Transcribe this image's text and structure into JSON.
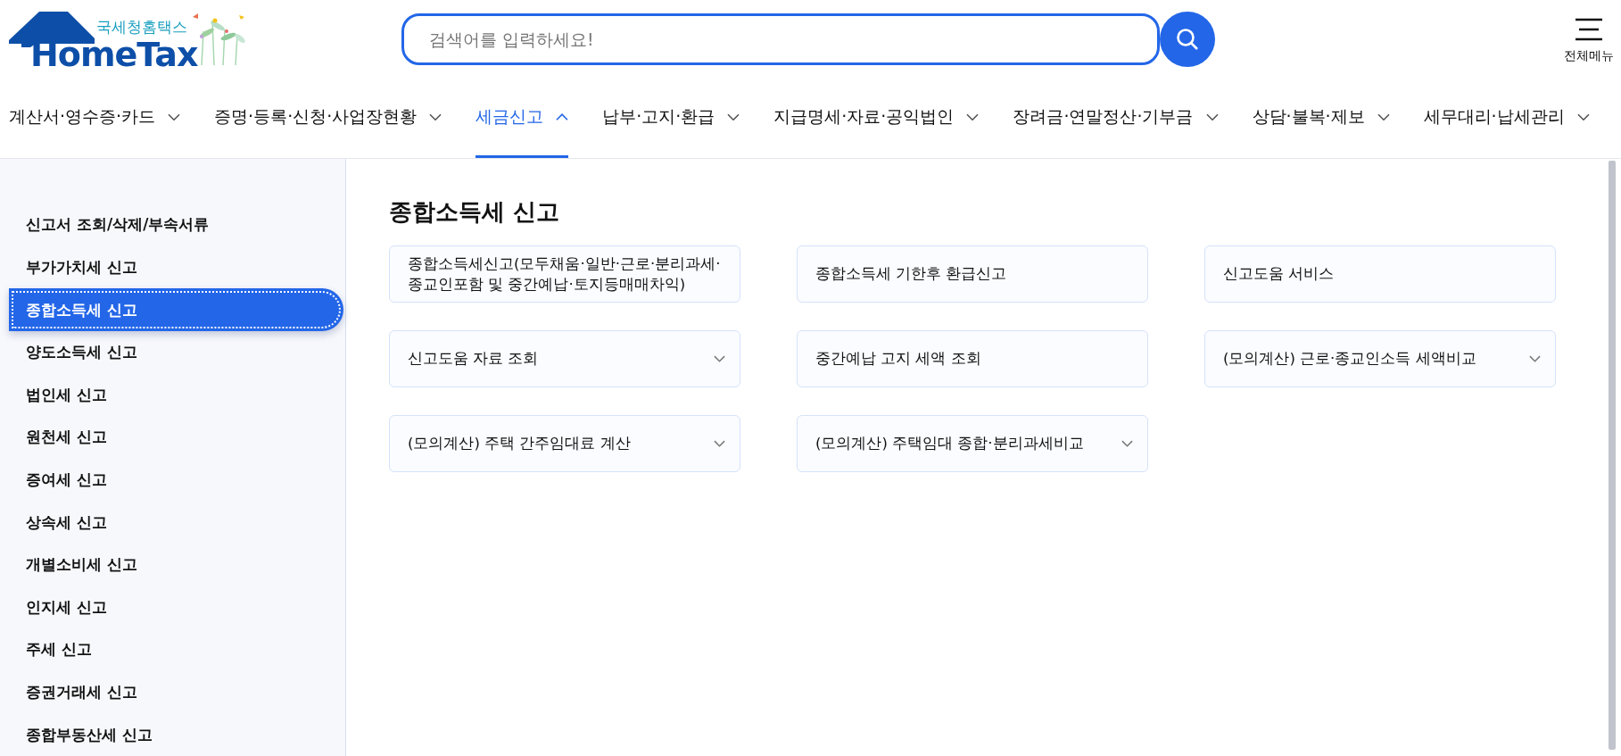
{
  "logo": {
    "subtitle": "국세청홈택스",
    "title": "HomeTax"
  },
  "search": {
    "placeholder": "검색어를 입력하세요!"
  },
  "all_menu": {
    "label": "전체메뉴"
  },
  "nav": [
    {
      "label": "계산서·영수증·카드",
      "selected": false
    },
    {
      "label": "증명·등록·신청·사업장현황",
      "selected": false
    },
    {
      "label": "세금신고",
      "selected": true
    },
    {
      "label": "납부·고지·환급",
      "selected": false
    },
    {
      "label": "지급명세·자료·공익법인",
      "selected": false
    },
    {
      "label": "장려금·연말정산·기부금",
      "selected": false
    },
    {
      "label": "상담·불복·제보",
      "selected": false
    },
    {
      "label": "세무대리·납세관리",
      "selected": false
    }
  ],
  "sidebar": {
    "items": [
      {
        "label": "신고서 조회/삭제/부속서류",
        "selected": false
      },
      {
        "label": "부가가치세 신고",
        "selected": false
      },
      {
        "label": "종합소득세 신고",
        "selected": true
      },
      {
        "label": "양도소득세 신고",
        "selected": false
      },
      {
        "label": "법인세 신고",
        "selected": false
      },
      {
        "label": "원천세 신고",
        "selected": false
      },
      {
        "label": "증여세 신고",
        "selected": false
      },
      {
        "label": "상속세 신고",
        "selected": false
      },
      {
        "label": "개별소비세 신고",
        "selected": false
      },
      {
        "label": "인지세 신고",
        "selected": false
      },
      {
        "label": "주세 신고",
        "selected": false
      },
      {
        "label": "증권거래세 신고",
        "selected": false
      },
      {
        "label": "종합부동산세 신고",
        "selected": false
      }
    ]
  },
  "content": {
    "title": "종합소득세 신고",
    "cards": [
      {
        "label": "종합소득세신고(모두채움·일반·근로·분리과세·종교인포함 및 중간예납·토지등매매차익)",
        "kind": "link"
      },
      {
        "label": "종합소득세 기한후 환급신고",
        "kind": "link"
      },
      {
        "label": "신고도움 서비스",
        "kind": "link"
      },
      {
        "label": "신고도움 자료 조회",
        "kind": "dropdown"
      },
      {
        "label": "중간예납 고지 세액 조회",
        "kind": "link"
      },
      {
        "label": "(모의계산) 근로·종교인소득 세액비교",
        "kind": "dropdown"
      },
      {
        "label": "(모의계산) 주택 간주임대료 계산",
        "kind": "dropdown"
      },
      {
        "label": "(모의계산) 주택임대 종합·분리과세비교",
        "kind": "dropdown"
      }
    ]
  }
}
